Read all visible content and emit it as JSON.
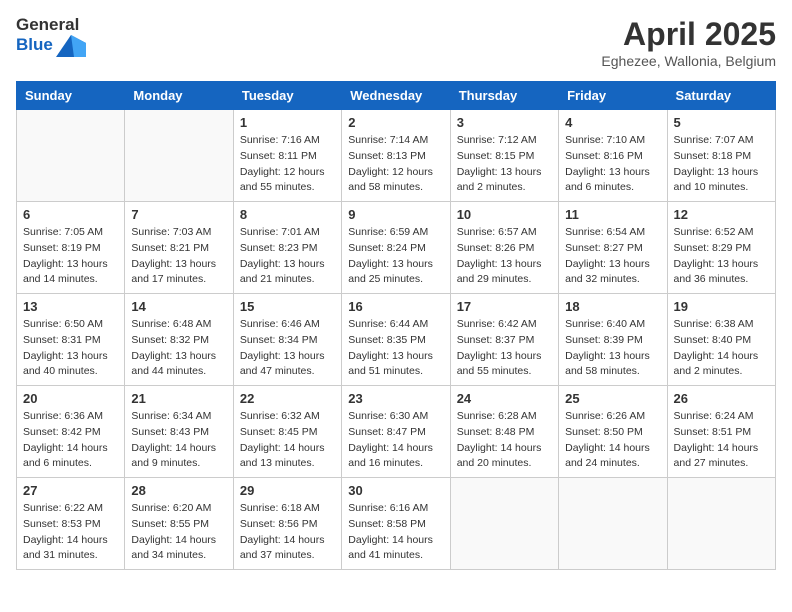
{
  "header": {
    "logo_general": "General",
    "logo_blue": "Blue",
    "month_title": "April 2025",
    "location": "Eghezee, Wallonia, Belgium"
  },
  "days_of_week": [
    "Sunday",
    "Monday",
    "Tuesday",
    "Wednesday",
    "Thursday",
    "Friday",
    "Saturday"
  ],
  "weeks": [
    [
      {
        "day": "",
        "info": ""
      },
      {
        "day": "",
        "info": ""
      },
      {
        "day": "1",
        "info": "Sunrise: 7:16 AM\nSunset: 8:11 PM\nDaylight: 12 hours and 55 minutes."
      },
      {
        "day": "2",
        "info": "Sunrise: 7:14 AM\nSunset: 8:13 PM\nDaylight: 12 hours and 58 minutes."
      },
      {
        "day": "3",
        "info": "Sunrise: 7:12 AM\nSunset: 8:15 PM\nDaylight: 13 hours and 2 minutes."
      },
      {
        "day": "4",
        "info": "Sunrise: 7:10 AM\nSunset: 8:16 PM\nDaylight: 13 hours and 6 minutes."
      },
      {
        "day": "5",
        "info": "Sunrise: 7:07 AM\nSunset: 8:18 PM\nDaylight: 13 hours and 10 minutes."
      }
    ],
    [
      {
        "day": "6",
        "info": "Sunrise: 7:05 AM\nSunset: 8:19 PM\nDaylight: 13 hours and 14 minutes."
      },
      {
        "day": "7",
        "info": "Sunrise: 7:03 AM\nSunset: 8:21 PM\nDaylight: 13 hours and 17 minutes."
      },
      {
        "day": "8",
        "info": "Sunrise: 7:01 AM\nSunset: 8:23 PM\nDaylight: 13 hours and 21 minutes."
      },
      {
        "day": "9",
        "info": "Sunrise: 6:59 AM\nSunset: 8:24 PM\nDaylight: 13 hours and 25 minutes."
      },
      {
        "day": "10",
        "info": "Sunrise: 6:57 AM\nSunset: 8:26 PM\nDaylight: 13 hours and 29 minutes."
      },
      {
        "day": "11",
        "info": "Sunrise: 6:54 AM\nSunset: 8:27 PM\nDaylight: 13 hours and 32 minutes."
      },
      {
        "day": "12",
        "info": "Sunrise: 6:52 AM\nSunset: 8:29 PM\nDaylight: 13 hours and 36 minutes."
      }
    ],
    [
      {
        "day": "13",
        "info": "Sunrise: 6:50 AM\nSunset: 8:31 PM\nDaylight: 13 hours and 40 minutes."
      },
      {
        "day": "14",
        "info": "Sunrise: 6:48 AM\nSunset: 8:32 PM\nDaylight: 13 hours and 44 minutes."
      },
      {
        "day": "15",
        "info": "Sunrise: 6:46 AM\nSunset: 8:34 PM\nDaylight: 13 hours and 47 minutes."
      },
      {
        "day": "16",
        "info": "Sunrise: 6:44 AM\nSunset: 8:35 PM\nDaylight: 13 hours and 51 minutes."
      },
      {
        "day": "17",
        "info": "Sunrise: 6:42 AM\nSunset: 8:37 PM\nDaylight: 13 hours and 55 minutes."
      },
      {
        "day": "18",
        "info": "Sunrise: 6:40 AM\nSunset: 8:39 PM\nDaylight: 13 hours and 58 minutes."
      },
      {
        "day": "19",
        "info": "Sunrise: 6:38 AM\nSunset: 8:40 PM\nDaylight: 14 hours and 2 minutes."
      }
    ],
    [
      {
        "day": "20",
        "info": "Sunrise: 6:36 AM\nSunset: 8:42 PM\nDaylight: 14 hours and 6 minutes."
      },
      {
        "day": "21",
        "info": "Sunrise: 6:34 AM\nSunset: 8:43 PM\nDaylight: 14 hours and 9 minutes."
      },
      {
        "day": "22",
        "info": "Sunrise: 6:32 AM\nSunset: 8:45 PM\nDaylight: 14 hours and 13 minutes."
      },
      {
        "day": "23",
        "info": "Sunrise: 6:30 AM\nSunset: 8:47 PM\nDaylight: 14 hours and 16 minutes."
      },
      {
        "day": "24",
        "info": "Sunrise: 6:28 AM\nSunset: 8:48 PM\nDaylight: 14 hours and 20 minutes."
      },
      {
        "day": "25",
        "info": "Sunrise: 6:26 AM\nSunset: 8:50 PM\nDaylight: 14 hours and 24 minutes."
      },
      {
        "day": "26",
        "info": "Sunrise: 6:24 AM\nSunset: 8:51 PM\nDaylight: 14 hours and 27 minutes."
      }
    ],
    [
      {
        "day": "27",
        "info": "Sunrise: 6:22 AM\nSunset: 8:53 PM\nDaylight: 14 hours and 31 minutes."
      },
      {
        "day": "28",
        "info": "Sunrise: 6:20 AM\nSunset: 8:55 PM\nDaylight: 14 hours and 34 minutes."
      },
      {
        "day": "29",
        "info": "Sunrise: 6:18 AM\nSunset: 8:56 PM\nDaylight: 14 hours and 37 minutes."
      },
      {
        "day": "30",
        "info": "Sunrise: 6:16 AM\nSunset: 8:58 PM\nDaylight: 14 hours and 41 minutes."
      },
      {
        "day": "",
        "info": ""
      },
      {
        "day": "",
        "info": ""
      },
      {
        "day": "",
        "info": ""
      }
    ]
  ]
}
